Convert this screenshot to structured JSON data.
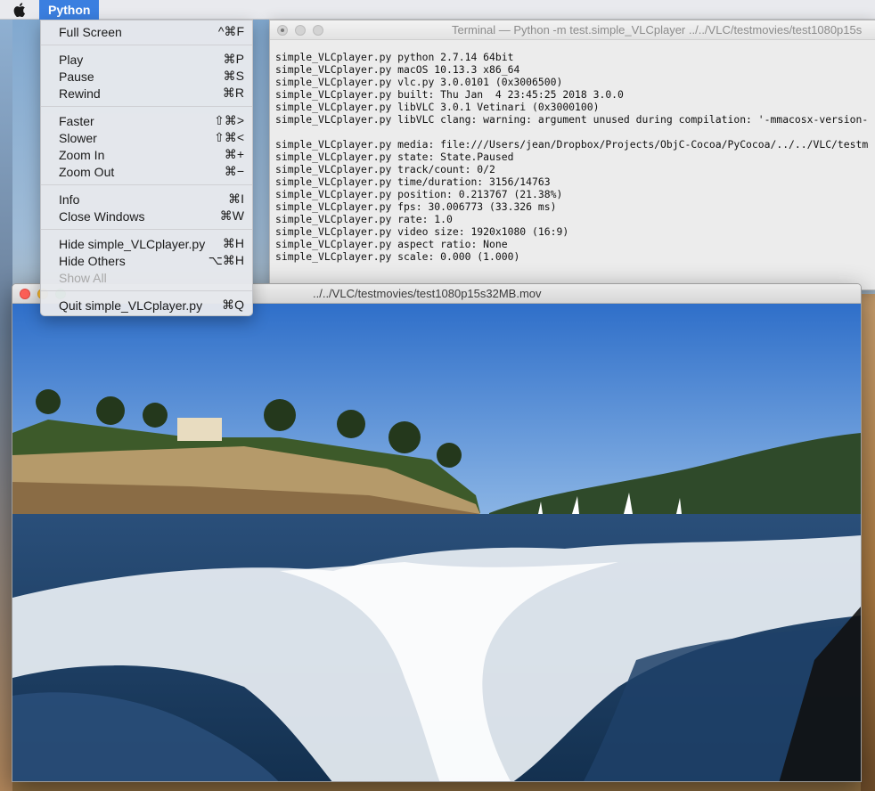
{
  "menubar": {
    "app_name": "Python"
  },
  "menu": {
    "groups": [
      [
        {
          "label": "Full Screen",
          "shortcut": "^⌘F",
          "enabled": true
        }
      ],
      [
        {
          "label": "Play",
          "shortcut": "⌘P",
          "enabled": true
        },
        {
          "label": "Pause",
          "shortcut": "⌘S",
          "enabled": true
        },
        {
          "label": "Rewind",
          "shortcut": "⌘R",
          "enabled": true
        }
      ],
      [
        {
          "label": "Faster",
          "shortcut": "⇧⌘>",
          "enabled": true
        },
        {
          "label": "Slower",
          "shortcut": "⇧⌘<",
          "enabled": true
        },
        {
          "label": "Zoom In",
          "shortcut": "⌘+",
          "enabled": true
        },
        {
          "label": "Zoom Out",
          "shortcut": "⌘−",
          "enabled": true
        }
      ],
      [
        {
          "label": "Info",
          "shortcut": "⌘I",
          "enabled": true
        },
        {
          "label": "Close Windows",
          "shortcut": "⌘W",
          "enabled": true
        }
      ],
      [
        {
          "label": "Hide simple_VLCplayer.py",
          "shortcut": "⌘H",
          "enabled": true
        },
        {
          "label": "Hide Others",
          "shortcut": "⌥⌘H",
          "enabled": true
        },
        {
          "label": "Show All",
          "shortcut": "",
          "enabled": false
        }
      ],
      [
        {
          "label": "Quit simple_VLCplayer.py",
          "shortcut": "⌘Q",
          "enabled": true
        }
      ]
    ]
  },
  "terminal": {
    "title": "Terminal — Python -m test.simple_VLCplayer ../../VLC/testmovies/test1080p15s",
    "lines": [
      "simple_VLCplayer.py python 2.7.14 64bit",
      "simple_VLCplayer.py macOS 10.13.3 x86_64",
      "simple_VLCplayer.py vlc.py 3.0.0101 (0x3006500)",
      "simple_VLCplayer.py built: Thu Jan  4 23:45:25 2018 3.0.0",
      "simple_VLCplayer.py libVLC 3.0.1 Vetinari (0x3000100)",
      "simple_VLCplayer.py libVLC clang: warning: argument unused during compilation: '-mmacosx-version-",
      "",
      "simple_VLCplayer.py media: file:///Users/jean/Dropbox/Projects/ObjC-Cocoa/PyCocoa/../../VLC/testm",
      "simple_VLCplayer.py state: State.Paused",
      "simple_VLCplayer.py track/count: 0/2",
      "simple_VLCplayer.py time/duration: 3156/14763",
      "simple_VLCplayer.py position: 0.213767 (21.38%)",
      "simple_VLCplayer.py fps: 30.006773 (33.326 ms)",
      "simple_VLCplayer.py rate: 1.0",
      "simple_VLCplayer.py video size: 1920x1080 (16:9)",
      "simple_VLCplayer.py aspect ratio: None",
      "simple_VLCplayer.py scale: 0.000 (1.000)"
    ]
  },
  "video_window": {
    "title": "../../VLC/testmovies/test1080p15s32MB.mov"
  },
  "colors": {
    "menu_highlight": "#3b7fe0",
    "close_button": "#fc5f57",
    "minimize_button": "#fdbc2e",
    "zoom_button": "#2ac83f"
  }
}
